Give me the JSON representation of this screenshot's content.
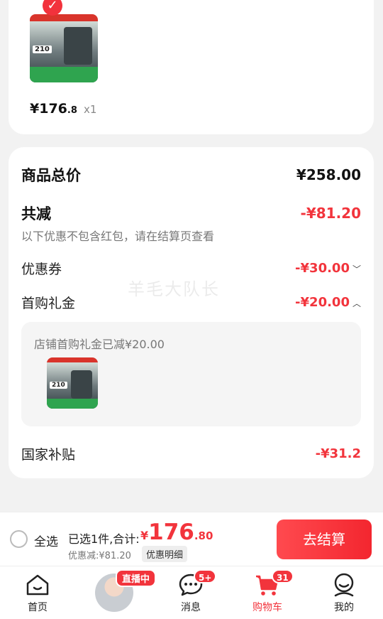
{
  "product_card": {
    "price_main": "¥176",
    "price_decimal": ".8",
    "quantity": "x1",
    "thumb_tag": "210"
  },
  "summary": {
    "total_label": "商品总价",
    "total_value": "¥258.00",
    "reduce_label": "共减",
    "reduce_value": "-¥81.20",
    "note": "以下优惠不包含红包，请在结算页查看",
    "coupon_label": "优惠券",
    "coupon_value": "-¥30.00",
    "gift_label": "首购礼金",
    "gift_value": "-¥20.00",
    "gift_detail": "店铺首购礼金已减¥20.00",
    "subsidy_label": "国家补贴",
    "subsidy_value": "-¥31.2",
    "watermark": "羊毛大队长"
  },
  "checkout": {
    "select_all": "全选",
    "selected_text": "已选1件,合计:",
    "currency": "¥",
    "total_int": "176",
    "total_dec": ".80",
    "discount_text": "优惠减:¥81.20",
    "detail_label": "优惠明细",
    "pay_label": "去结算"
  },
  "tabbar": {
    "home": "首页",
    "live_badge": "直播中",
    "messages": "消息",
    "messages_badge": "5+",
    "cart": "购物车",
    "cart_badge": "31",
    "me": "我的"
  },
  "colors": {
    "accent": "#f2343c",
    "background": "#f2f2f2"
  }
}
